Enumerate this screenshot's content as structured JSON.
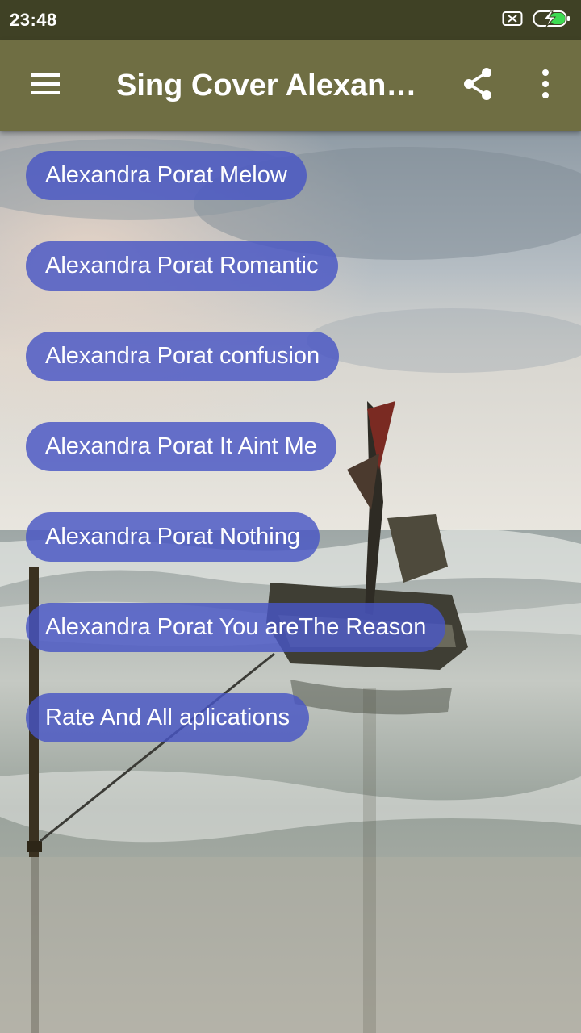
{
  "status": {
    "time": "23:48"
  },
  "app_bar": {
    "title": "Sing Cover Alexandra Porat",
    "menu_icon": "hamburger-menu-icon",
    "share_icon": "share-icon",
    "more_icon": "more-vert-icon"
  },
  "menu": {
    "items": [
      {
        "label": "Alexandra Porat Melow"
      },
      {
        "label": "Alexandra Porat Romantic"
      },
      {
        "label": "Alexandra Porat confusion"
      },
      {
        "label": "Alexandra Porat It Aint Me"
      },
      {
        "label": "Alexandra Porat Nothing"
      },
      {
        "label": "Alexandra Porat You areThe Reason"
      },
      {
        "label": "Rate And All aplications"
      }
    ]
  },
  "colors": {
    "status_bar": "#3f4125",
    "app_bar": "#6f6e43",
    "pill": "#4856c4"
  }
}
